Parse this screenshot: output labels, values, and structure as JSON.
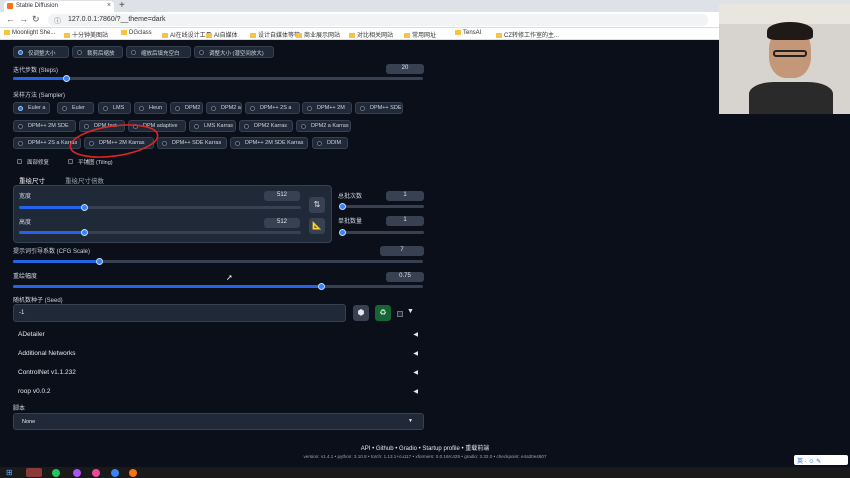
{
  "browser": {
    "tab_title": "Stable Diffusion",
    "url": "127.0.0.1:7860/?__theme=dark",
    "bookmarks": [
      "Moonlight She...",
      "十分钟美图站",
      "DGclass",
      "AI在线设计工具",
      "AI自媒体",
      "设计自媒体等等",
      "商业展示网站",
      "对比相关网站",
      "常用网址",
      "TensAI",
      "CZ转修工作室的主..."
    ]
  },
  "resize": {
    "options": [
      "仅调整大小",
      "裁剪后缩放",
      "缩放后填充空白",
      "调整大小 (潜空间放大)"
    ],
    "selected": 0
  },
  "steps": {
    "label": "迭代步数 (Steps)",
    "value": "20",
    "fraction": 0.13
  },
  "sampler": {
    "label": "采样方法 (Sampler)",
    "options": [
      "Euler a",
      "Euler",
      "LMS",
      "Heun",
      "DPM2",
      "DPM2 a",
      "DPM++ 2S a",
      "DPM++ 2M",
      "DPM++ SDE",
      "DPM++ 2M SDE",
      "DPM fast",
      "DPM adaptive",
      "LMS Karras",
      "DPM2 Karras",
      "DPM2 a Karras",
      "DPM++ 2S a Karras",
      "DPM++ 2M Karras",
      "DPM++ SDE Karras",
      "DPM++ 2M SDE Karras",
      "DDIM"
    ],
    "selected": 0
  },
  "checks": {
    "restore_faces": "面部修复",
    "tiling": "平铺图 (Tiling)"
  },
  "tabs": {
    "resize_to": "重绘尺寸",
    "resize_by": "重绘尺寸倍数"
  },
  "width": {
    "label": "宽度",
    "value": "512",
    "fraction": 0.23
  },
  "height": {
    "label": "高度",
    "value": "512",
    "fraction": 0.23
  },
  "batch_count": {
    "label": "总批次数",
    "value": "1",
    "fraction": 0.02
  },
  "batch_size": {
    "label": "单批数量",
    "value": "1",
    "fraction": 0.02
  },
  "cfg": {
    "label": "提示词引导系数 (CFG Scale)",
    "value": "7",
    "fraction": 0.21
  },
  "denoise": {
    "label": "重绘幅度",
    "value": "0.75",
    "fraction": 0.75
  },
  "seed": {
    "label": "随机数种子 (Seed)",
    "value": "-1"
  },
  "accordions": [
    "ADetailer",
    "Additional Networks",
    "ControlNet v1.1.232",
    "roop v0.0.2"
  ],
  "script": {
    "label": "脚本",
    "value": "None"
  },
  "footer": {
    "links": "API  •  Github  •  Gradio  •  Startup profile  •  重载前端",
    "versions": "version: v1.4.1  •  python: 3.10.8  •  torch: 1.13.1+cu117  •  xformers: 0.0.16rc425  •  gradio: 3.32.0  •  checkpoint: e4a30e4607"
  },
  "colors": {
    "accent": "#2563eb",
    "background": "#0b0f19",
    "panel": "#1f2937",
    "annotation": "#dc2626"
  }
}
